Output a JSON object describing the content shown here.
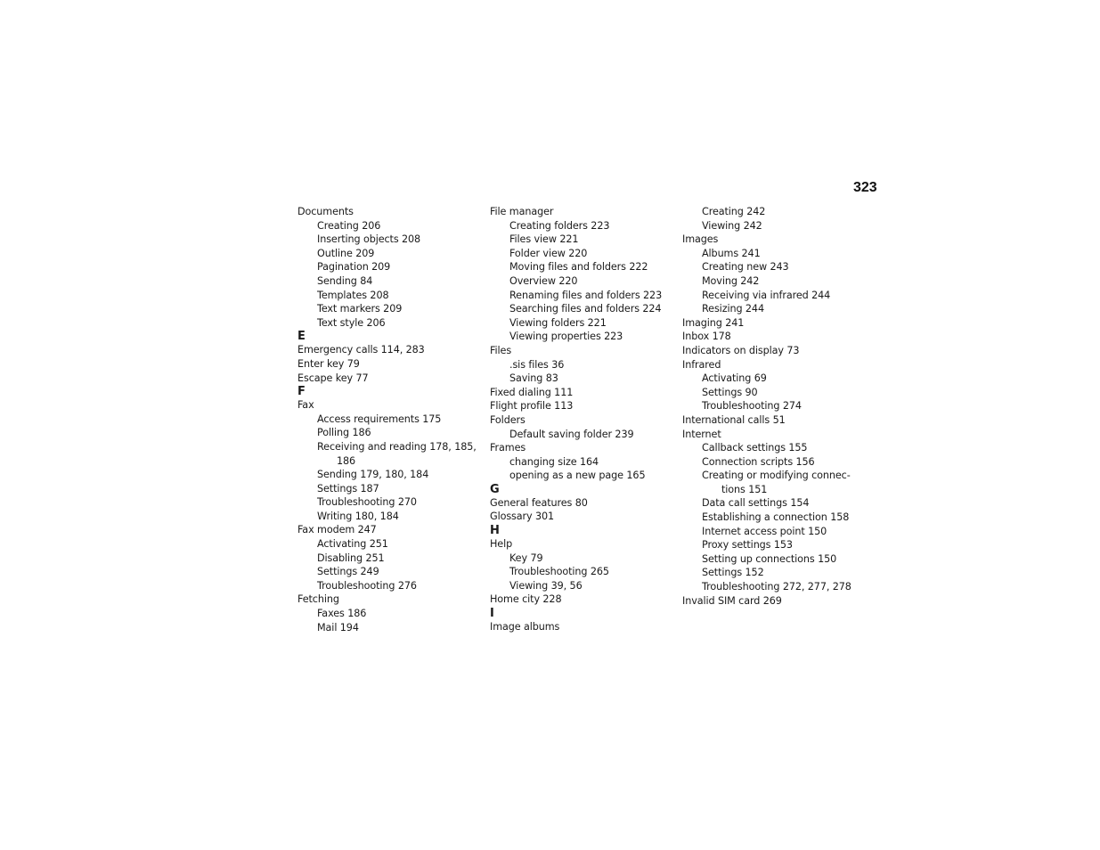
{
  "page_number": "323",
  "columns": [
    {
      "entries": [
        {
          "type": "main",
          "text": "Documents"
        },
        {
          "type": "sub",
          "text": "Creating 206"
        },
        {
          "type": "sub",
          "text": "Inserting objects 208"
        },
        {
          "type": "sub",
          "text": "Outline 209"
        },
        {
          "type": "sub",
          "text": "Pagination 209"
        },
        {
          "type": "sub",
          "text": "Sending 84"
        },
        {
          "type": "sub",
          "text": "Templates 208"
        },
        {
          "type": "sub",
          "text": "Text markers 209"
        },
        {
          "type": "sub",
          "text": "Text style 206"
        },
        {
          "type": "letter",
          "text": "E"
        },
        {
          "type": "main",
          "text": "Emergency calls 114, 283"
        },
        {
          "type": "main",
          "text": "Enter key 79"
        },
        {
          "type": "main",
          "text": "Escape key 77"
        },
        {
          "type": "letter",
          "text": "F"
        },
        {
          "type": "main",
          "text": "Fax"
        },
        {
          "type": "sub",
          "text": "Access requirements 175"
        },
        {
          "type": "sub",
          "text": "Polling 186"
        },
        {
          "type": "sub",
          "text": "Receiving and reading 178, 185,"
        },
        {
          "type": "subcont",
          "text": "186"
        },
        {
          "type": "sub",
          "text": "Sending 179, 180, 184"
        },
        {
          "type": "sub",
          "text": "Settings 187"
        },
        {
          "type": "sub",
          "text": "Troubleshooting 270"
        },
        {
          "type": "sub",
          "text": "Writing 180, 184"
        },
        {
          "type": "main",
          "text": "Fax modem 247"
        },
        {
          "type": "sub",
          "text": "Activating 251"
        },
        {
          "type": "sub",
          "text": "Disabling 251"
        },
        {
          "type": "sub",
          "text": "Settings 249"
        },
        {
          "type": "sub",
          "text": "Troubleshooting 276"
        },
        {
          "type": "main",
          "text": "Fetching"
        },
        {
          "type": "sub",
          "text": "Faxes 186"
        },
        {
          "type": "sub",
          "text": "Mail 194"
        }
      ]
    },
    {
      "entries": [
        {
          "type": "main",
          "text": "File manager"
        },
        {
          "type": "sub",
          "text": "Creating folders 223"
        },
        {
          "type": "sub",
          "text": "Files view 221"
        },
        {
          "type": "sub",
          "text": "Folder view 220"
        },
        {
          "type": "sub",
          "text": "Moving files and folders 222"
        },
        {
          "type": "sub",
          "text": "Overview 220"
        },
        {
          "type": "sub",
          "text": "Renaming files and folders 223"
        },
        {
          "type": "sub",
          "text": "Searching files and folders 224"
        },
        {
          "type": "sub",
          "text": "Viewing folders 221"
        },
        {
          "type": "sub",
          "text": "Viewing properties 223"
        },
        {
          "type": "main",
          "text": "Files"
        },
        {
          "type": "sub",
          "text": ".sis files 36"
        },
        {
          "type": "sub",
          "text": "Saving 83"
        },
        {
          "type": "main",
          "text": "Fixed dialing 111"
        },
        {
          "type": "main",
          "text": "Flight profile 113"
        },
        {
          "type": "main",
          "text": "Folders"
        },
        {
          "type": "sub",
          "text": "Default saving folder 239"
        },
        {
          "type": "main",
          "text": "Frames"
        },
        {
          "type": "sub",
          "text": "changing size 164"
        },
        {
          "type": "sub",
          "text": "opening as a new page 165"
        },
        {
          "type": "letter",
          "text": "G"
        },
        {
          "type": "main",
          "text": "General features 80"
        },
        {
          "type": "main",
          "text": "Glossary 301"
        },
        {
          "type": "letter",
          "text": "H"
        },
        {
          "type": "main",
          "text": "Help"
        },
        {
          "type": "sub",
          "text": "Key 79"
        },
        {
          "type": "sub",
          "text": "Troubleshooting 265"
        },
        {
          "type": "sub",
          "text": "Viewing 39, 56"
        },
        {
          "type": "main",
          "text": "Home city 228"
        },
        {
          "type": "letter",
          "text": "I"
        },
        {
          "type": "main",
          "text": "Image albums"
        }
      ]
    },
    {
      "entries": [
        {
          "type": "sub",
          "text": "Creating 242"
        },
        {
          "type": "sub",
          "text": "Viewing 242"
        },
        {
          "type": "main",
          "text": "Images"
        },
        {
          "type": "sub",
          "text": "Albums 241"
        },
        {
          "type": "sub",
          "text": "Creating new 243"
        },
        {
          "type": "sub",
          "text": "Moving 242"
        },
        {
          "type": "sub",
          "text": "Receiving via infrared 244"
        },
        {
          "type": "sub",
          "text": "Resizing 244"
        },
        {
          "type": "main",
          "text": "Imaging 241"
        },
        {
          "type": "main",
          "text": "Inbox 178"
        },
        {
          "type": "main",
          "text": "Indicators on display 73"
        },
        {
          "type": "main",
          "text": "Infrared"
        },
        {
          "type": "sub",
          "text": "Activating 69"
        },
        {
          "type": "sub",
          "text": "Settings 90"
        },
        {
          "type": "sub",
          "text": "Troubleshooting 274"
        },
        {
          "type": "main",
          "text": "International calls 51"
        },
        {
          "type": "main",
          "text": "Internet"
        },
        {
          "type": "sub",
          "text": "Callback settings 155"
        },
        {
          "type": "sub",
          "text": "Connection scripts 156"
        },
        {
          "type": "sub",
          "text": "Creating or modifying connec-"
        },
        {
          "type": "subcont",
          "text": "tions 151"
        },
        {
          "type": "sub",
          "text": "Data call settings 154"
        },
        {
          "type": "sub",
          "text": "Establishing a connection 158"
        },
        {
          "type": "sub",
          "text": "Internet access point 150"
        },
        {
          "type": "sub",
          "text": "Proxy settings 153"
        },
        {
          "type": "sub",
          "text": "Setting up connections 150"
        },
        {
          "type": "sub",
          "text": "Settings 152"
        },
        {
          "type": "sub",
          "text": "Troubleshooting 272, 277, 278"
        },
        {
          "type": "main",
          "text": "Invalid SIM card 269"
        }
      ]
    }
  ]
}
